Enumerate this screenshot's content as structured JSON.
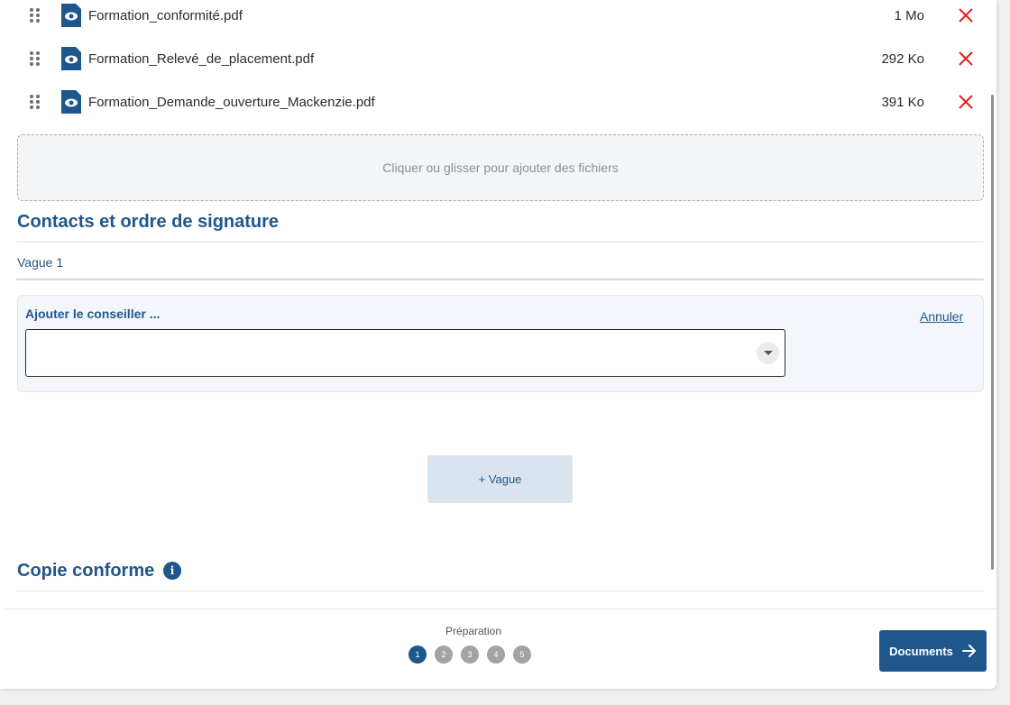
{
  "files": [
    {
      "name": "Formation_conformité.pdf",
      "size": "1 Mo"
    },
    {
      "name": "Formation_Relevé_de_placement.pdf",
      "size": "292 Ko"
    },
    {
      "name": "Formation_Demande_ouverture_Mackenzie.pdf",
      "size": "391 Ko"
    }
  ],
  "dropzone": {
    "text": "Cliquer ou glisser pour ajouter des fichiers"
  },
  "contacts": {
    "title": "Contacts et ordre de signature",
    "wave_tab": "Vague 1",
    "advisor_label": "Ajouter le conseiller ...",
    "cancel": "Annuler",
    "add_wave": "+ Vague"
  },
  "copy": {
    "title": "Copie conforme",
    "info_glyph": "i"
  },
  "footer": {
    "step_label": "Préparation",
    "steps": [
      "1",
      "2",
      "3",
      "4",
      "5"
    ],
    "active_step": 1,
    "next_label": "Documents"
  },
  "colors": {
    "accent": "#1f578c",
    "remove": "#e02020",
    "step_inactive": "#a3a3a3"
  }
}
